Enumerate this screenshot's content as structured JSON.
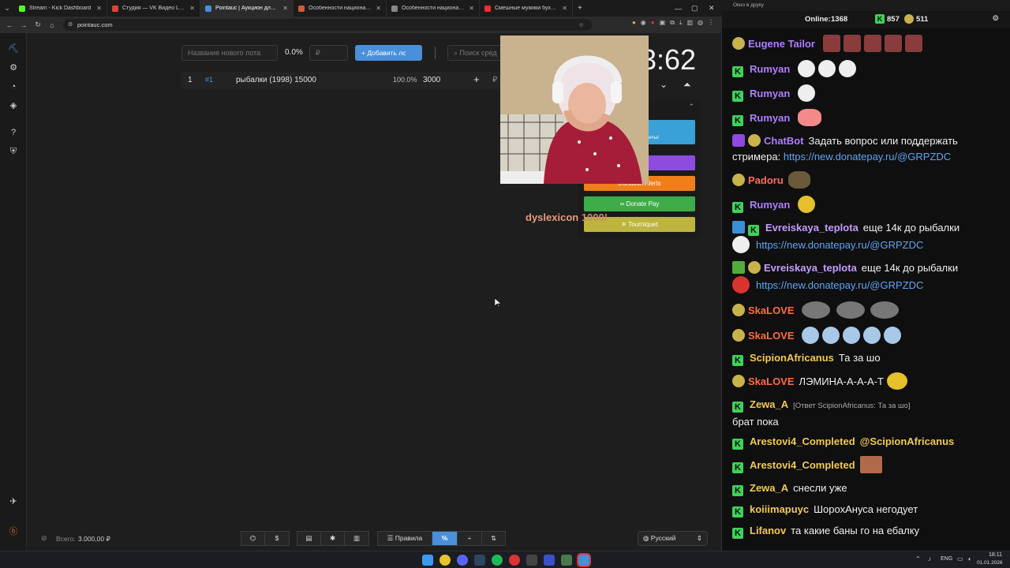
{
  "browser": {
    "tabs": [
      {
        "title": "Stream - Kick Dashboard",
        "color": "#53fc18",
        "active": false
      },
      {
        "title": "Студия — VK Видео Live",
        "color": "#e0413c",
        "active": false
      },
      {
        "title": "Pointauc | Аукцион для стрим",
        "color": "#4a8fd9",
        "active": true
      },
      {
        "title": "Особенности национальной р",
        "color": "#d65a2e",
        "active": false
      },
      {
        "title": "Особенности национальной р",
        "color": "#888888",
        "active": false
      },
      {
        "title": "Смешные мужики бухают на ",
        "color": "#ff2a2a",
        "active": false
      }
    ],
    "new_tab": "+",
    "url": "pointauc.com"
  },
  "toolbar": {
    "new_lot_placeholder": "Название нового лота",
    "percent": "0.0%",
    "amount_placeholder": "₽",
    "add_button": "Добавить лс",
    "search_placeholder": "Поиск сред"
  },
  "timer": "3:62",
  "lots": [
    {
      "index": "1",
      "id": "#1",
      "name": "рыбалки (1998) 15000",
      "percent": "100.0%",
      "amount": "3000",
      "add": "+",
      "currency": "₽"
    }
  ],
  "widget": {
    "donate_title": "onate",
    "donate_sub": "льные виджеты!",
    "twitch": "ch",
    "donation_alerts": "Donation Alerts",
    "donate_pay": "Donate Pay",
    "tourniquet": "Tourniquet",
    "overlay_text": "dyslexicon",
    "overlay_amount": "1000!"
  },
  "bottom": {
    "total_label": "Всего:",
    "total_value": "3.000,00 ₽",
    "rules": "Правила",
    "percent_btn": "%",
    "language": "Русский"
  },
  "chat": {
    "window_title": "Окно в друку",
    "online_label": "Online:",
    "online_value": "1368",
    "kick_count": "857",
    "other_count": "511",
    "messages": [
      {
        "user": "Eugene Tailor",
        "color": "#b07cff",
        "text": ""
      },
      {
        "user": "Rumyan",
        "color": "#b07cff",
        "text": ""
      },
      {
        "user": "Rumyan",
        "color": "#b07cff",
        "text": ""
      },
      {
        "user": "Rumyan",
        "color": "#b07cff",
        "text": ""
      },
      {
        "user": "ChatBot",
        "color": "#b07cff",
        "text": "Задать вопрос или поддержать стримера:",
        "link": "https://new.donatepay.ru/@GRPZDC"
      },
      {
        "user": "Padoru",
        "color": "#ff6b5a",
        "text": ""
      },
      {
        "user": "Rumyan",
        "color": "#b07cff",
        "text": ""
      },
      {
        "user": "Evreiskaya_teplota",
        "color": "#c79bff",
        "text": "еще 14к до рыбалки",
        "link": "https://new.donatepay.ru/@GRPZDC"
      },
      {
        "user": "Evreiskaya_teplota",
        "color": "#c79bff",
        "text": "еще 14к до рыбалки",
        "link": "https://new.donatepay.ru/@GRPZDC"
      },
      {
        "user": "SkaLOVE",
        "color": "#ff6b3d",
        "text": ""
      },
      {
        "user": "SkaLOVE",
        "color": "#ff6b3d",
        "text": ""
      },
      {
        "user": "ScipionAfricanus",
        "color": "#f2c94c",
        "text": "Та за шо"
      },
      {
        "user": "SkaLOVE",
        "color": "#ff6b3d",
        "text": "ЛЭМИНА-А-А-А-Т"
      },
      {
        "user": "Zewa_A",
        "color": "#f2c94c",
        "reply": "[Ответ ScipionAfricanus: Та за шо]",
        "text": "брат пока"
      },
      {
        "user": "Arestovi4_Completed",
        "color": "#f2c94c",
        "text": "@ScipionAfricanus"
      },
      {
        "user": "Arestovi4_Completed",
        "color": "#f2c94c",
        "text": ""
      },
      {
        "user": "Zewa_A",
        "color": "#f2c94c",
        "text": "снесли уже"
      },
      {
        "user": "koiiimapuyc",
        "color": "#f2c94c",
        "text": "ШорохАнуса негодует"
      },
      {
        "user": "Lifanov",
        "color": "#f2c94c",
        "text": "та какие баны го на ебалку"
      }
    ]
  },
  "taskbar": {
    "lang": "ENG",
    "time": "18:11",
    "date": "01.01.2026"
  }
}
